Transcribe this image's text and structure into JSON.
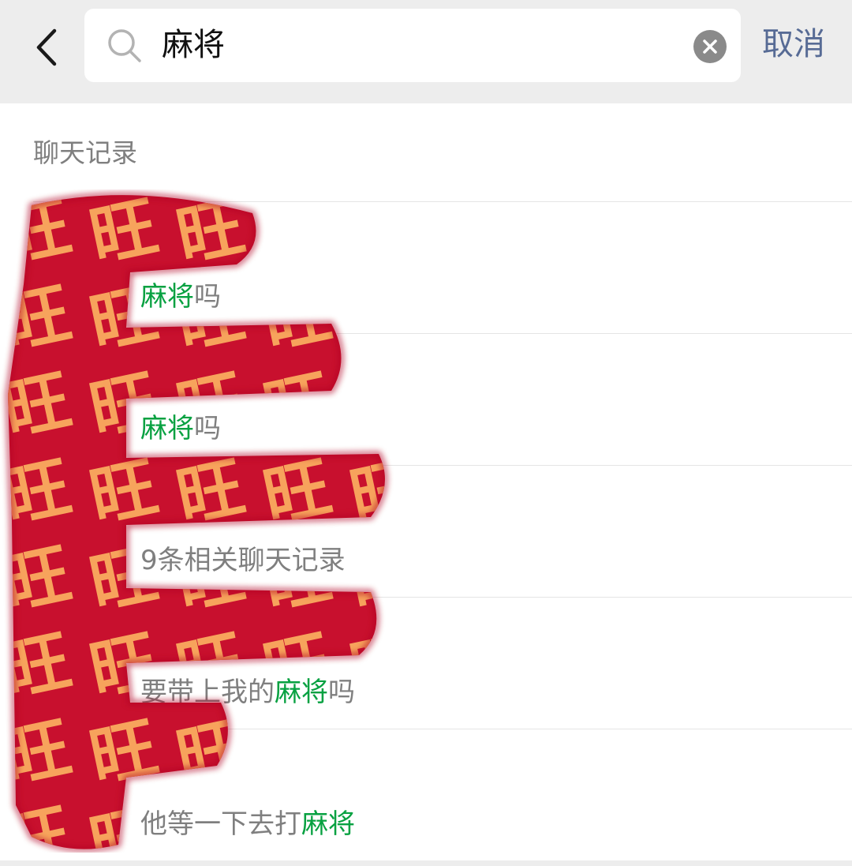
{
  "search": {
    "query": "麻将",
    "cancel_label": "取消"
  },
  "section": {
    "label": "聊天记录"
  },
  "results": [
    {
      "name": "",
      "pre": "",
      "match": "麻将",
      "post": "吗"
    },
    {
      "name": "",
      "pre": "",
      "match": "麻将",
      "post": "吗"
    },
    {
      "name": "",
      "pre": "9条相关聊天记录",
      "match": "",
      "post": ""
    },
    {
      "name": "",
      "pre": "要带上我的",
      "match": "麻将",
      "post": "吗"
    },
    {
      "name": "",
      "pre": "他等一下去打",
      "match": "麻将",
      "post": ""
    }
  ],
  "sticker": {
    "text": "旺",
    "fill_color": "#c8102e",
    "text_color": "#f7a35c"
  },
  "colors": {
    "highlight": "#07a141",
    "link": "#576b95",
    "secondary_text": "#7f7f7f",
    "header_bg": "#ededed"
  },
  "icons": [
    "back-arrow-icon",
    "search-icon",
    "clear-icon"
  ]
}
